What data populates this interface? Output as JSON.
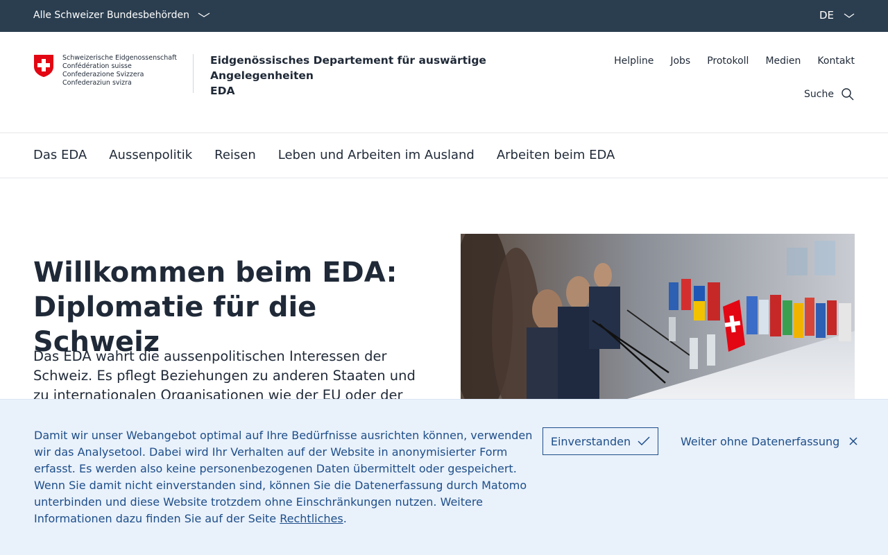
{
  "topbar": {
    "authorities_label": "Alle Schweizer Bundesbehörden",
    "language": "DE"
  },
  "header": {
    "logo_lines": [
      "Schweizerische Eidgenossenschaft",
      "Confédération suisse",
      "Confederazione Svizzera",
      "Confederaziun svizra"
    ],
    "department_line1": "Eidgenössisches Departement für auswärtige Angelegenheiten",
    "department_line2": "EDA",
    "meta_nav": [
      "Helpline",
      "Jobs",
      "Protokoll",
      "Medien",
      "Kontakt"
    ],
    "search_label": "Suche"
  },
  "main_nav": [
    "Das EDA",
    "Aussenpolitik",
    "Reisen",
    "Leben und Arbeiten im Ausland",
    "Arbeiten beim EDA"
  ],
  "hero": {
    "title_line1": "Willkommen beim EDA:",
    "title_line2": "Diplomatie für die Schweiz",
    "text": "Das EDA wahrt die aussenpolitischen Interessen der Schweiz. Es pflegt Beziehungen zu anderen Staaten und zu internationalen Organisationen wie der EU oder der UNO."
  },
  "cookie_banner": {
    "text": "Damit wir unser Webangebot optimal auf Ihre Bedürfnisse ausrichten können, verwenden wir das Analysetool. Dabei wird Ihr Verhalten auf der Website in anonymisierter Form erfasst. Es werden also keine personenbezogenen Daten übermittelt oder gespeichert. Wenn Sie damit nicht einverstanden sind, können Sie die Datenerfassung durch Matomo unterbinden und diese Website trotzdem ohne Einschränkungen nutzen. Weitere Informationen dazu finden Sie auf der Seite",
    "link_label": "Rechtliches",
    "period": ".",
    "accept_label": "Einverstanden",
    "decline_label": "Weiter ohne Datenerfassung"
  },
  "colors": {
    "topbar_bg": "#2b3e50",
    "swiss_red": "#e30613",
    "banner_bg": "#e9f1fb",
    "banner_text": "#1d4e89"
  },
  "icons": [
    "chevron-down-icon",
    "swiss-cross-icon",
    "search-icon",
    "check-icon",
    "close-icon"
  ]
}
